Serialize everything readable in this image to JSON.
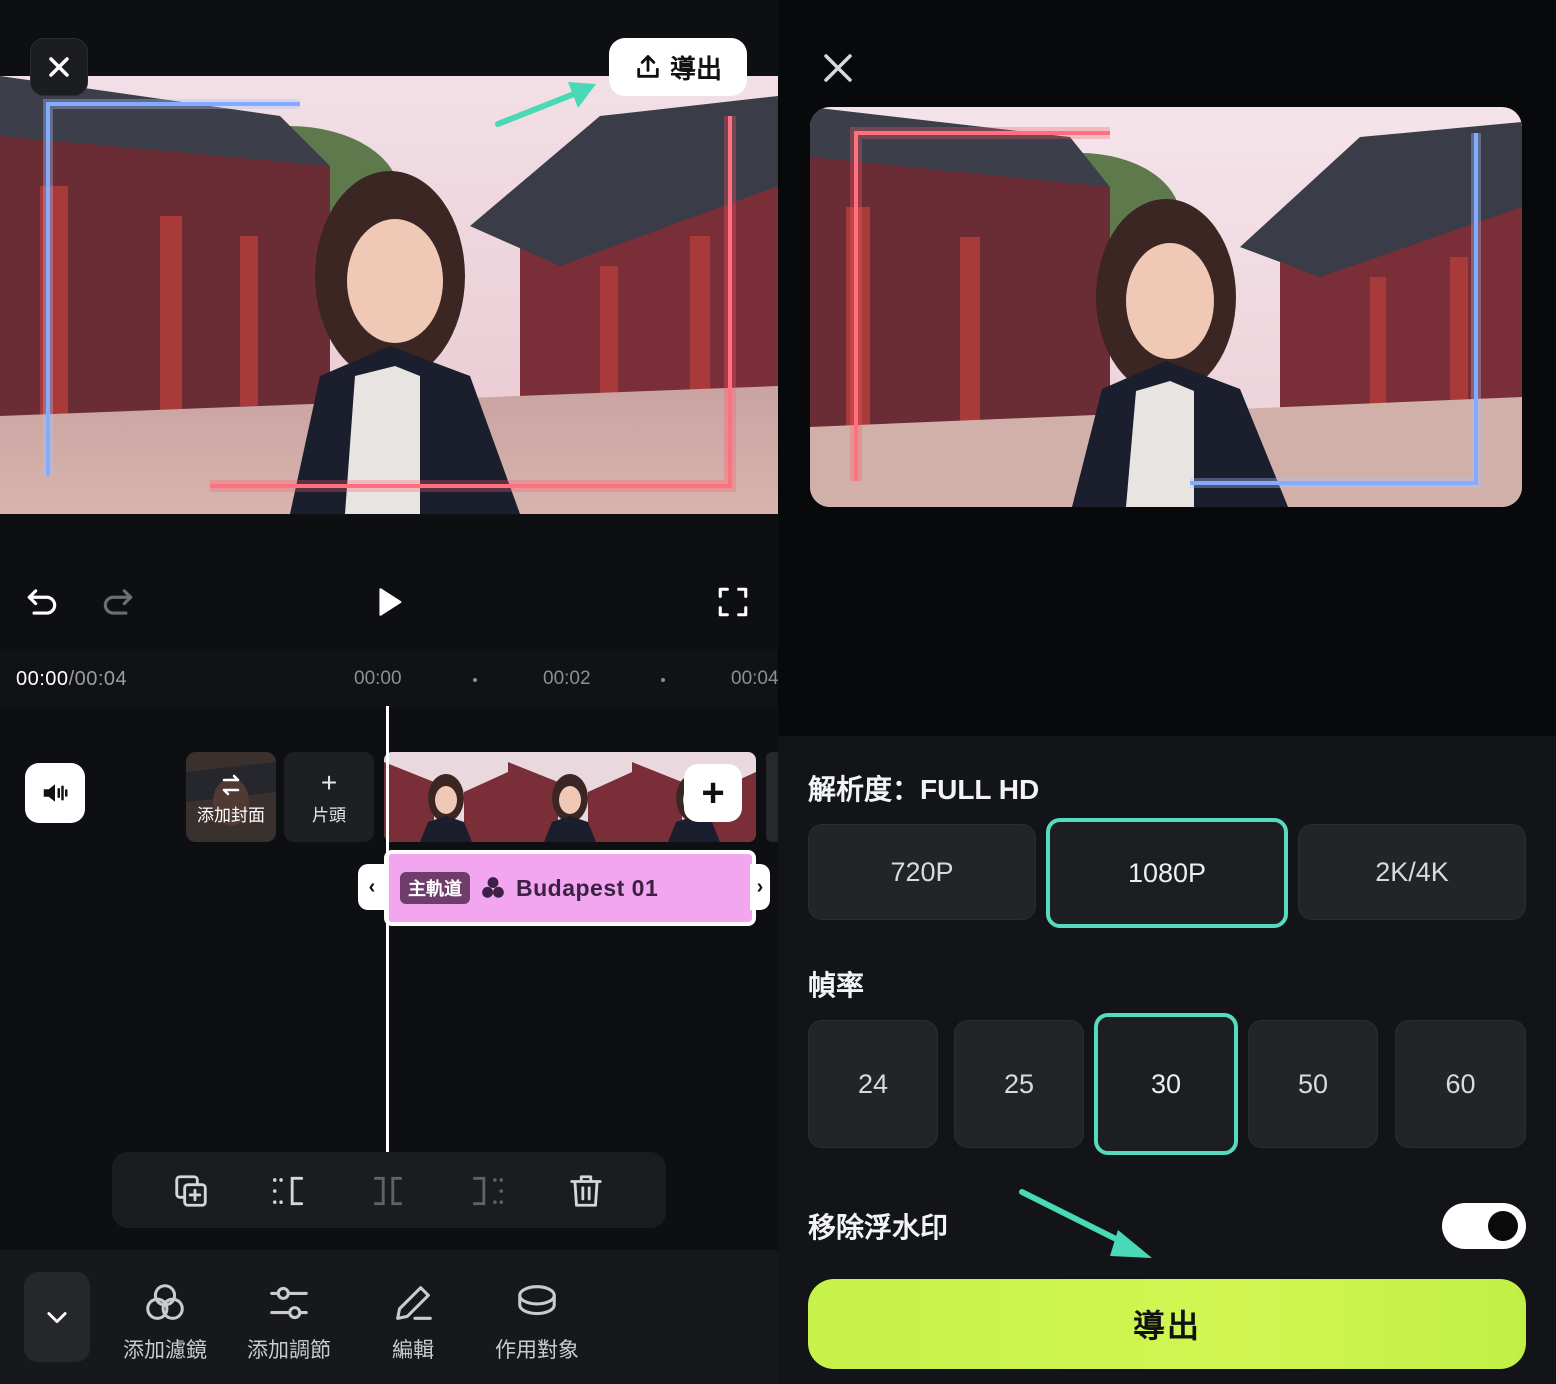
{
  "editor": {
    "export_label": "導出",
    "time_current": "00:00",
    "time_total": "/00:04",
    "ticks": [
      "00:00",
      "00:02",
      "00:04"
    ],
    "cover_label": "添加封面",
    "intro_label": "片頭",
    "track_tag": "主軌道",
    "track_name": "Budapest 01",
    "bottom_items": [
      {
        "label": "添加濾鏡",
        "icon": "filter-icon"
      },
      {
        "label": "添加調節",
        "icon": "adjust-icon"
      },
      {
        "label": "編輯",
        "icon": "pencil-icon"
      },
      {
        "label": "作用對象",
        "icon": "layers-icon"
      }
    ]
  },
  "export_panel": {
    "resolution_title": "解析度：FULL HD",
    "resolutions": [
      "720P",
      "1080P",
      "2K/4K"
    ],
    "resolution_selected": "1080P",
    "framerate_title": "幀率",
    "framerates": [
      "24",
      "25",
      "30",
      "50",
      "60"
    ],
    "framerate_selected": "30",
    "watermark_label": "移除浮水印",
    "watermark_toggle_on": true,
    "export_button": "導出"
  },
  "colors": {
    "accent_teal": "#55dcbf",
    "export_green": "#c6f24a",
    "track_pink": "#f3a6f0"
  }
}
